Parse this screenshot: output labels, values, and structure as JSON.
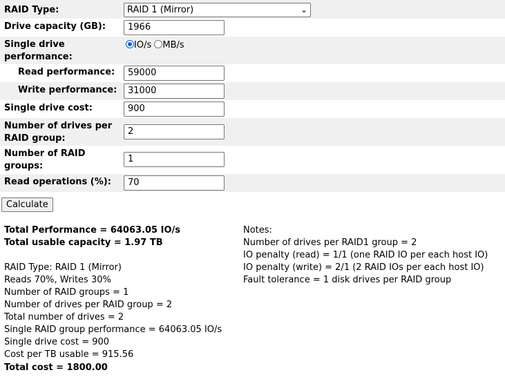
{
  "form": {
    "raid_type": {
      "label": "RAID Type:",
      "value": "RAID 1 (Mirror)"
    },
    "drive_capacity": {
      "label": "Drive capacity (GB):",
      "value": "1966"
    },
    "single_perf": {
      "label_line1": "Single drive",
      "label_line2": "performance:",
      "unit_iops": "IO/s",
      "unit_mbs": "MB/s",
      "selected": "IO/s"
    },
    "read_perf": {
      "label": "Read performance:",
      "value": "59000"
    },
    "write_perf": {
      "label": "Write performance:",
      "value": "31000"
    },
    "drive_cost": {
      "label": "Single drive cost:",
      "value": "900"
    },
    "drives_per_group": {
      "label_line1": "Number of drives per",
      "label_line2": "RAID group:",
      "value": "2"
    },
    "raid_groups": {
      "label_line1": "Number of RAID",
      "label_line2": "groups:",
      "value": "1"
    },
    "read_ops": {
      "label": "Read operations (%):",
      "value": "70"
    },
    "calculate_label": "Calculate"
  },
  "results": {
    "total_performance": "Total Performance = 64063.05 IO/s",
    "total_capacity": "Total usable capacity = 1.97 TB",
    "details": [
      "RAID Type: RAID 1 (Mirror)",
      "Reads 70%, Writes 30%",
      "Number of RAID groups = 1",
      "Number of drives per RAID group = 2",
      "Total number of drives = 2",
      "Single RAID group performance = 64063.05 IO/s",
      "Single drive cost = 900",
      "Cost per TB usable = 915.56"
    ],
    "total_cost": "Total cost = 1800.00"
  },
  "notes": {
    "title": "Notes:",
    "items": [
      "Number of drives per RAID1 group = 2",
      "IO penalty (read) = 1/1 (one RAID IO per each host IO)",
      "IO penalty (write) = 2/1 (2 RAID IOs per each host IO)",
      "Fault tolerance = 1 disk drives per RAID group"
    ]
  }
}
